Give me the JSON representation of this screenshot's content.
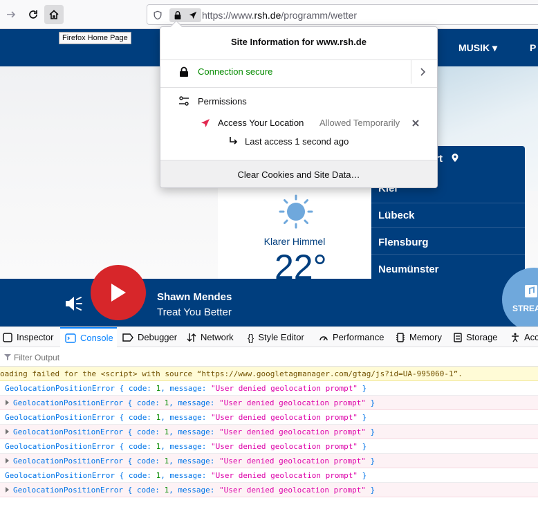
{
  "browser": {
    "url_prefix": "https://www.",
    "url_domain": "rsh.de",
    "url_path": "/programm/wetter",
    "tooltip": "Firefox Home Page"
  },
  "site": {
    "nav_musik": "MUSIK ▾",
    "nav_p": "P",
    "weather": {
      "condition": "Klarer Himmel",
      "temperature": "22°"
    },
    "cities_header": "ort",
    "cities": [
      "Kiel",
      "Lübeck",
      "Flensburg",
      "Neumünster"
    ],
    "player": {
      "artist": "Shawn Mendes",
      "song": "Treat You Better",
      "stream_label": "STREA"
    }
  },
  "site_info": {
    "title": "Site Information for www.rsh.de",
    "connection": "Connection secure",
    "permissions_label": "Permissions",
    "location_label": "Access Your Location",
    "location_state": "Allowed Temporarily",
    "last_access": "Last access 1 second ago",
    "clear_button": "Clear Cookies and Site Data…"
  },
  "devtools": {
    "tabs": [
      "Inspector",
      "Console",
      "Debugger",
      "Network",
      "Style Editor",
      "Performance",
      "Memory",
      "Storage",
      "Acc"
    ],
    "active_tab": "Console",
    "filter_placeholder": "Filter Output",
    "warning": "oading failed for the <script> with source “https://www.googletagmanager.com/gtag/js?id=UA-995060-1”.",
    "messages": [
      {
        "expandable": false,
        "name": "GeolocationPositionError",
        "code": "1",
        "message": "\"User denied geolocation prompt\""
      },
      {
        "expandable": true,
        "name": "GeolocationPositionError",
        "code": "1",
        "message": "\"User denied geolocation prompt\""
      },
      {
        "expandable": false,
        "name": "GeolocationPositionError",
        "code": "1",
        "message": "\"User denied geolocation prompt\""
      },
      {
        "expandable": true,
        "name": "GeolocationPositionError",
        "code": "1",
        "message": "\"User denied geolocation prompt\""
      },
      {
        "expandable": false,
        "name": "GeolocationPositionError",
        "code": "1",
        "message": "\"User denied geolocation prompt\""
      },
      {
        "expandable": true,
        "name": "GeolocationPositionError",
        "code": "1",
        "message": "\"User denied geolocation prompt\""
      },
      {
        "expandable": false,
        "name": "GeolocationPositionError",
        "code": "1",
        "message": "\"User denied geolocation prompt\""
      },
      {
        "expandable": true,
        "name": "GeolocationPositionError",
        "code": "1",
        "message": "\"User denied geolocation prompt\""
      }
    ]
  },
  "colors": {
    "brand": "#003e7e",
    "play": "#d7262a",
    "secure": "#058b00",
    "accent": "#0a84ff"
  }
}
